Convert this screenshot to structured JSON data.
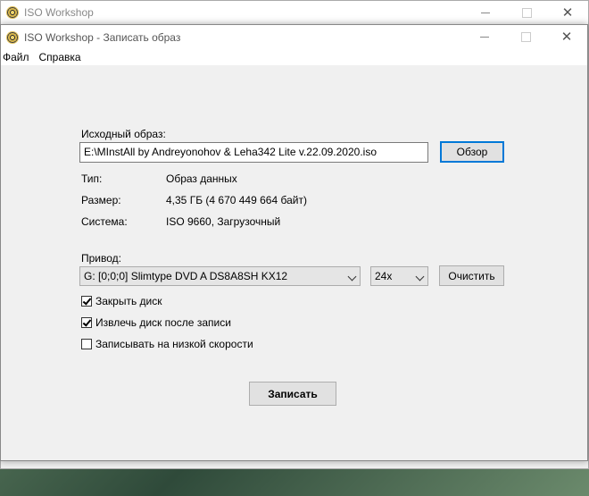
{
  "background_window": {
    "title": "ISO Workshop"
  },
  "dialog": {
    "title": "ISO Workshop - Записать образ",
    "menu": [
      {
        "label": "Файл"
      },
      {
        "label": "Справка"
      }
    ],
    "source": {
      "label": "Исходный образ:",
      "path": "E:\\MInstAll by Andreyonohov & Leha342 Lite v.22.09.2020.iso",
      "browse_label": "Обзор"
    },
    "info": {
      "type_label": "Тип:",
      "type_value": "Образ данных",
      "size_label": "Размер:",
      "size_value": "4,35 ГБ (4 670 449 664 байт)",
      "system_label": "Система:",
      "system_value": "ISO 9660, Загрузочный"
    },
    "drive": {
      "label": "Привод:",
      "selected": "G:  [0;0;0] Slimtype DVD A  DS8A8SH KX12",
      "speed": "24x",
      "erase_label": "Очистить"
    },
    "options": {
      "close_disc": {
        "label": "Закрыть диск",
        "checked": true
      },
      "eject_after": {
        "label": "Извлечь диск после записи",
        "checked": true
      },
      "low_speed": {
        "label": "Записывать на низкой скорости",
        "checked": false
      }
    },
    "burn_label": "Записать"
  }
}
